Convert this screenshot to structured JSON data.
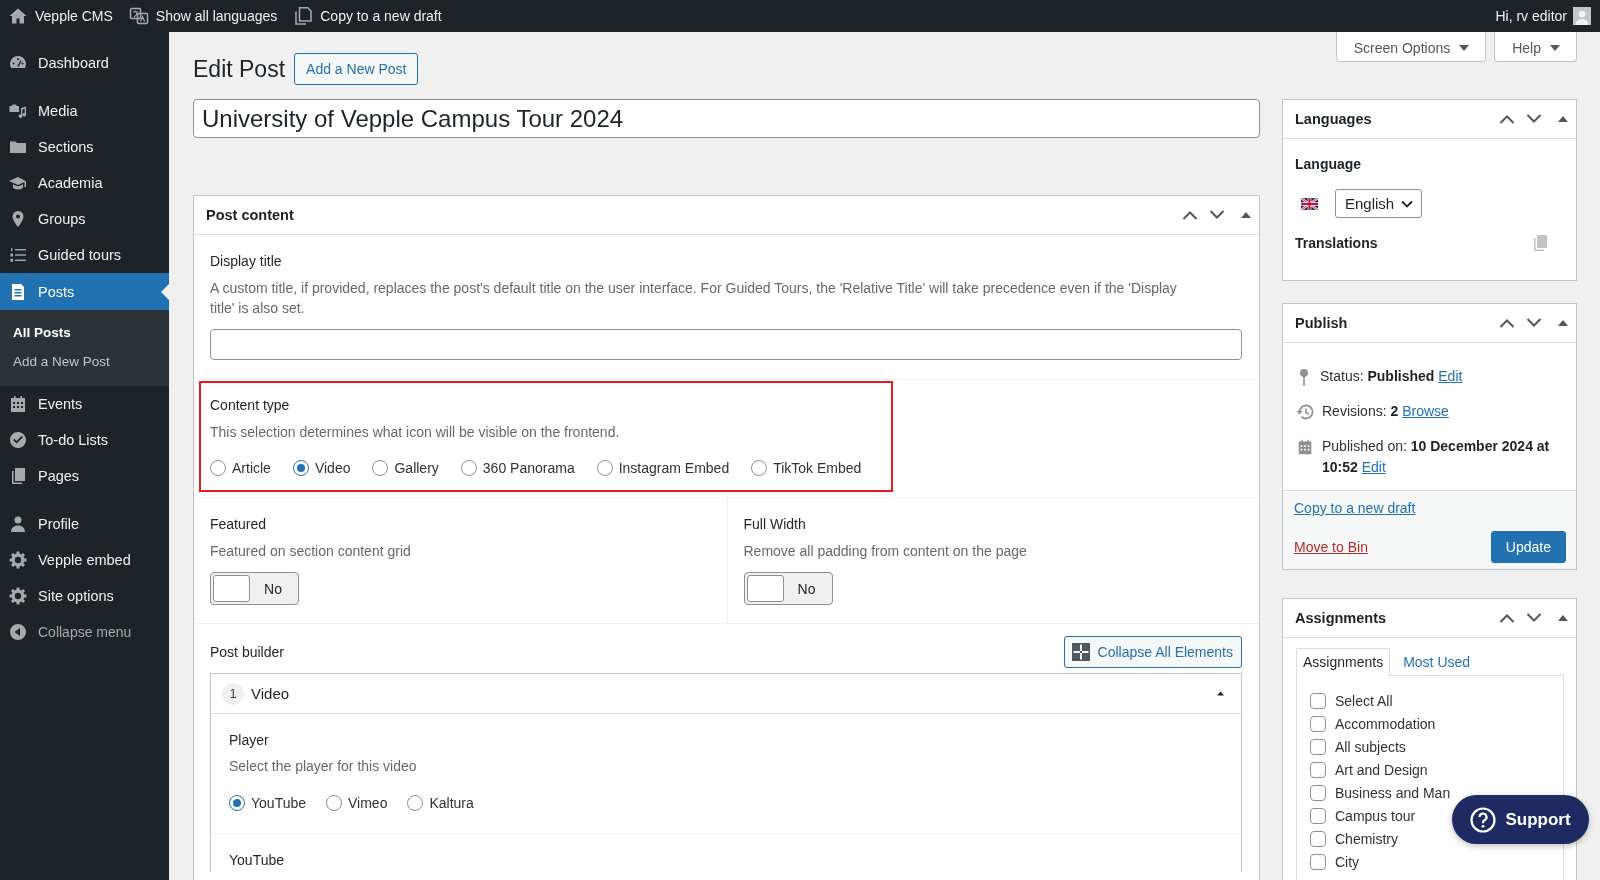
{
  "admin_bar": {
    "items": [
      {
        "label": "Vepple CMS"
      },
      {
        "label": "Show all languages"
      },
      {
        "label": "Copy to a new draft"
      }
    ],
    "account": "Hi, rv editor"
  },
  "sidebar": {
    "groups": [
      [
        {
          "label": "Dashboard",
          "selected": false
        }
      ],
      [
        {
          "label": "Media",
          "selected": false
        },
        {
          "label": "Sections",
          "selected": false
        },
        {
          "label": "Academia",
          "selected": false
        },
        {
          "label": "Groups",
          "selected": false
        },
        {
          "label": "Guided tours",
          "selected": false
        },
        {
          "label": "Posts",
          "selected": true,
          "children": [
            {
              "label": "All Posts",
              "selected": true
            },
            {
              "label": "Add a New Post",
              "selected": false
            }
          ]
        },
        {
          "label": "Events",
          "selected": false
        },
        {
          "label": "To-do Lists",
          "selected": false
        },
        {
          "label": "Pages",
          "selected": false
        }
      ],
      [
        {
          "label": "Profile",
          "selected": false
        },
        {
          "label": "Vepple embed",
          "selected": false
        },
        {
          "label": "Site options",
          "selected": false
        }
      ]
    ],
    "collapse": "Collapse menu"
  },
  "screen_meta": {
    "buttons": [
      {
        "label": "Screen Options",
        "expanded": false
      },
      {
        "label": "Help",
        "expanded": false
      }
    ]
  },
  "header": {
    "title": "Edit Post",
    "add_new_button": "Add a New Post"
  },
  "post_title": {
    "value": "University of Vepple Campus Tour 2024"
  },
  "post_content": {
    "title": "Post content",
    "display_title": {
      "label": "Display title",
      "description": "A custom title, if provided, replaces the post's default title on the user interface. For Guided Tours, the 'Relative Title' will take precedence even if the 'Display title' is also set."
    },
    "content_type": {
      "label": "Content type",
      "description": "This selection determines what icon will be visible on the frontend.",
      "highlighted": true,
      "options": [
        {
          "label": "Article",
          "selected": false
        },
        {
          "label": "Video",
          "selected": true
        },
        {
          "label": "Gallery",
          "selected": false
        },
        {
          "label": "360 Panorama",
          "selected": false
        },
        {
          "label": "Instagram Embed",
          "selected": false
        },
        {
          "label": "TikTok Embed",
          "selected": false
        }
      ]
    },
    "toggles": [
      {
        "label": "Featured",
        "description": "Featured on section content grid",
        "on": false,
        "state_text": "No"
      },
      {
        "label": "Full Width",
        "description": "Remove all padding from content on the page",
        "on": false,
        "state_text": "No"
      }
    ],
    "post_builder": {
      "label": "Post builder",
      "collapse_button": "Collapse All Elements",
      "elements": [
        {
          "number": "1",
          "title": "Video",
          "expanded": true,
          "fields": [
            {
              "label": "Player",
              "description": "Select the player for this video",
              "options": [
                {
                  "label": "YouTube",
                  "selected": true
                },
                {
                  "label": "Vimeo",
                  "selected": false
                },
                {
                  "label": "Kaltura",
                  "selected": false
                }
              ]
            },
            {
              "label": "YouTube"
            }
          ]
        }
      ]
    }
  },
  "languages": {
    "title": "Languages",
    "language_label": "Language",
    "language_value": "English",
    "translations_label": "Translations"
  },
  "publish": {
    "title": "Publish",
    "rows": [
      {
        "text": "Status: **Published**",
        "link": "Edit"
      },
      {
        "text": "Revisions: **2**",
        "link": "Browse"
      },
      {
        "text": "Published on: **10 December 2024 at 10:52**",
        "link": "Edit"
      }
    ],
    "copy_link": "Copy to a new draft",
    "bin_link": "Move to Bin",
    "update_button": "Update"
  },
  "assignments": {
    "title": "Assignments",
    "tabs": [
      {
        "label": "Assignments",
        "selected": true
      },
      {
        "label": "Most Used",
        "selected": false
      }
    ],
    "items": [
      {
        "label": "Select All",
        "checked": false
      },
      {
        "label": "Accommodation",
        "checked": false
      },
      {
        "label": "All subjects",
        "checked": false
      },
      {
        "label": "Art and Design",
        "checked": false
      },
      {
        "label": "Business and Man",
        "checked": false
      },
      {
        "label": "Campus tour",
        "checked": false
      },
      {
        "label": "Chemistry",
        "checked": false
      },
      {
        "label": "City",
        "checked": false
      }
    ]
  },
  "support_button": {
    "label": "Support"
  }
}
